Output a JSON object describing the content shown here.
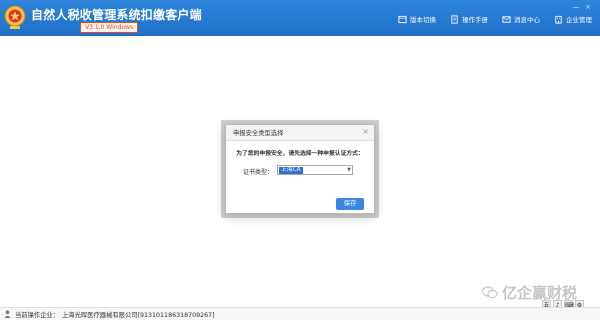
{
  "header": {
    "app_title": "自然人税收管理系统扣缴客户端",
    "version_badge": "V3.1.0 Windows",
    "toolbar": [
      {
        "icon": "switch-icon",
        "label": "版本切换"
      },
      {
        "icon": "manual-icon",
        "label": "操作手册"
      },
      {
        "icon": "message-icon",
        "label": "消息中心"
      },
      {
        "icon": "enterprise-icon",
        "label": "企业管理"
      }
    ],
    "window_controls": {
      "minimize": "—",
      "close": "×"
    },
    "colors": {
      "bar": "#1f6fc6",
      "badge": "#e34b2b"
    }
  },
  "dialog": {
    "title": "申报安全类型选择",
    "close": "×",
    "message": "为了您的申报安全，请先选择一种申报认证方式：",
    "cert_label": "证书类型：",
    "cert_value": "上海CA",
    "caret": "▼",
    "save_label": "保存",
    "colors": {
      "button": "#3b86df",
      "selection": "#2f6fd1"
    }
  },
  "statusbar": {
    "label": "当前操作企业：",
    "company": "上海光晖医疗器械有限公司[913101186318709267]"
  },
  "watermark": {
    "text": "亿企赢财税"
  },
  "tray": [
    "五",
    "♪",
    "⌨",
    "⚙"
  ]
}
